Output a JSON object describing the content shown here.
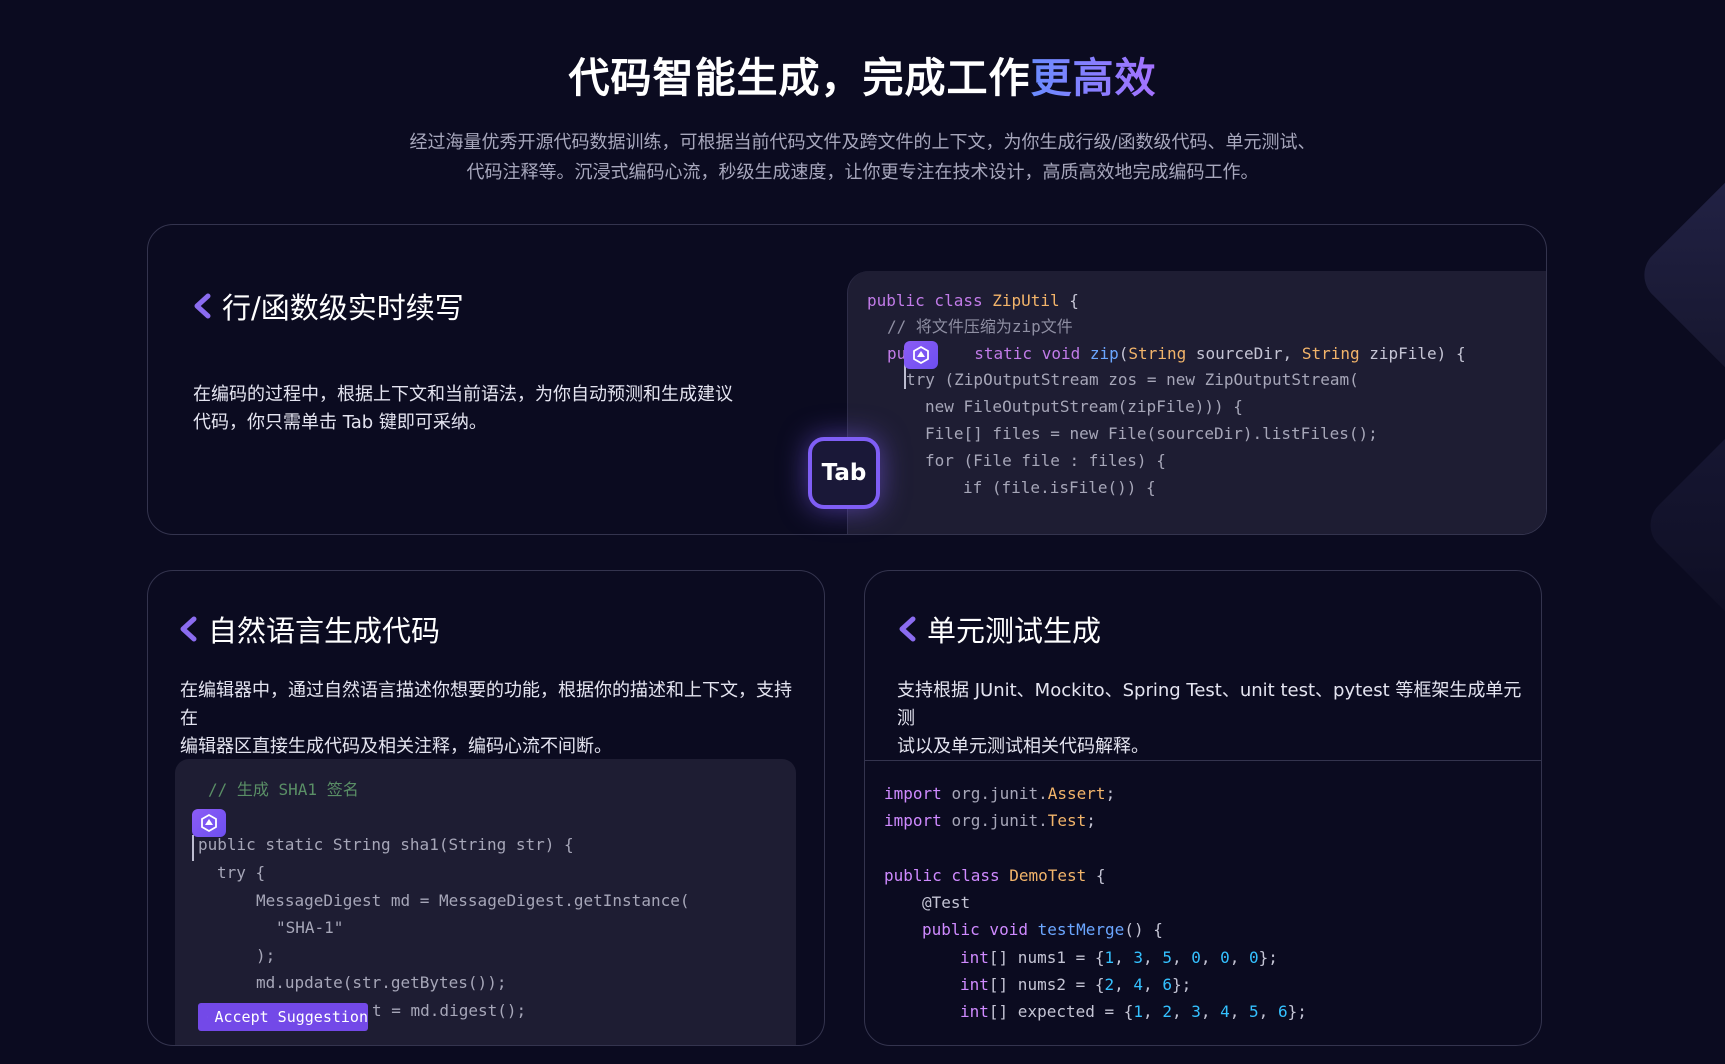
{
  "header": {
    "title_main": "代码智能生成，完成工作",
    "title_highlight": "更高效",
    "subtitle_line1": "经过海量优秀开源代码数据训练，可根据当前代码文件及跨文件的上下文，为你生成行级/函数级代码、单元测试、",
    "subtitle_line2": "代码注释等。沉浸式编码心流，秒级生成速度，让你更专注在技术设计，高质高效地完成编码工作。"
  },
  "cards": {
    "line_completion": {
      "title": "行/函数级实时续写",
      "desc_line1": "在编码的过程中，根据上下文和当前语法，为你自动预测和生成建议",
      "desc_line2": "代码，你只需单击 Tab 键即可采纳。",
      "tab_key_label": "Tab",
      "code": {
        "l1_kw": "public class",
        "l1_cls": "ZipUtil",
        "l1_rest": " {",
        "l2": "// 将文件压缩为zip文件",
        "l3_pre": "pu",
        "l3_kw": "static void",
        "l3_fn": "zip",
        "l3_a": "(",
        "l3_t1": "String",
        "l3_b": " sourceDir, ",
        "l3_t2": "String",
        "l3_c": " zipFile) {",
        "l4": "try (ZipOutputStream zos = new ZipOutputStream(",
        "l5": "new FileOutputStream(zipFile))) {",
        "l6": "File[] files = new File(sourceDir).listFiles();",
        "l7": "for (File file : files) {",
        "l8": "if (file.isFile()) {"
      }
    },
    "natural_language": {
      "title": "自然语言生成代码",
      "desc_line1": "在编辑器中，通过自然语言描述你想要的功能，根据你的描述和上下文，支持在",
      "desc_line2": "编辑器区直接生成代码及相关注释，编码心流不间断。",
      "accept_label": "Accept Suggestion",
      "code": {
        "l1": "// 生成 SHA1 签名",
        "l2": "public static String sha1(String str) {",
        "l3": "try {",
        "l4": "MessageDigest md = MessageDigest.getInstance(",
        "l5": "\"SHA-1\"",
        "l6": ");",
        "l7": "md.update(str.getBytes());",
        "l8": "t = md.digest();"
      }
    },
    "unit_test": {
      "title": "单元测试生成",
      "desc_line1": "支持根据 JUnit、Mockito、Spring Test、unit test、pytest 等框架生成单元测",
      "desc_line2": "试以及单元测试相关代码解释。",
      "code": {
        "import_kw": "import",
        "imp1_pkg": "org.junit.",
        "imp1_cls": "Assert",
        "imp2_pkg": "org.junit.",
        "imp2_cls": "Test",
        "semi": ";",
        "class_kw": "public class",
        "class_name": "DemoTest",
        "brace": " {",
        "annotation": "@Test",
        "method_kw": "public void",
        "method_name": "testMerge",
        "method_rest": "() {",
        "arr_type": "int",
        "nums1_name": "[] nums1 = {",
        "nums1_values": [
          "1",
          "3",
          "5",
          "0",
          "0",
          "0"
        ],
        "nums2_name": "[] nums2 = {",
        "nums2_values": [
          "2",
          "4",
          "6"
        ],
        "expected_name": "[] expected = {",
        "expected_values": [
          "1",
          "2",
          "3",
          "4",
          "5",
          "6"
        ],
        "close": "};"
      }
    }
  },
  "icons": {
    "chevron": "chevron-left-icon",
    "badge": "ai-assistant-logo-icon",
    "accept": "tab-arrow-icon"
  },
  "colors": {
    "background": "#0b0b20",
    "accent": "#7f5ef5",
    "highlight_gradient": [
      "#6a8cff",
      "#a571ff"
    ]
  }
}
